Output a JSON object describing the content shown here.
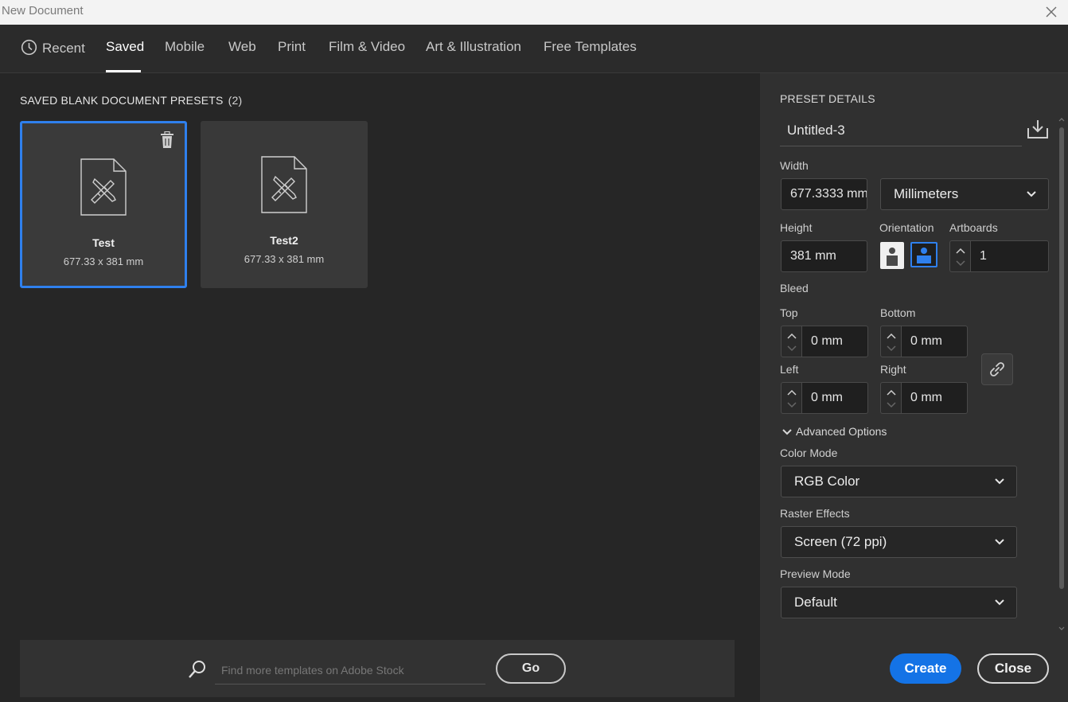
{
  "window": {
    "title": "New Document"
  },
  "tabs": [
    {
      "label": "Recent",
      "icon": "clock-icon"
    },
    {
      "label": "Saved"
    },
    {
      "label": "Mobile"
    },
    {
      "label": "Web"
    },
    {
      "label": "Print"
    },
    {
      "label": "Film & Video"
    },
    {
      "label": "Art & Illustration"
    },
    {
      "label": "Free Templates"
    }
  ],
  "presets": {
    "title": "SAVED BLANK DOCUMENT PRESETS",
    "count": "(2)",
    "items": [
      {
        "name": "Test",
        "size": "677.33 x 381 mm",
        "selected": true
      },
      {
        "name": "Test2",
        "size": "677.33 x 381 mm",
        "selected": false
      }
    ]
  },
  "stock": {
    "placeholder": "Find more templates on Adobe Stock",
    "go_label": "Go"
  },
  "details": {
    "title": "PRESET DETAILS",
    "name": "Untitled-3",
    "width_label": "Width",
    "width_value": "677.3333 mm",
    "units": "Millimeters",
    "height_label": "Height",
    "height_value": "381 mm",
    "orientation_label": "Orientation",
    "orientation_selected": "landscape",
    "artboards_label": "Artboards",
    "artboards_value": "1",
    "bleed_label": "Bleed",
    "bleed": {
      "top_label": "Top",
      "top": "0 mm",
      "bottom_label": "Bottom",
      "bottom": "0 mm",
      "left_label": "Left",
      "left": "0 mm",
      "right_label": "Right",
      "right": "0 mm"
    },
    "advanced_label": "Advanced Options",
    "color_mode_label": "Color Mode",
    "color_mode": "RGB Color",
    "raster_label": "Raster Effects",
    "raster": "Screen (72 ppi)",
    "preview_label": "Preview Mode",
    "preview": "Default"
  },
  "actions": {
    "create": "Create",
    "close": "Close"
  },
  "colors": {
    "accent": "#1473e6",
    "selection": "#2f80ed",
    "panel": "#303030",
    "background": "#262626"
  }
}
